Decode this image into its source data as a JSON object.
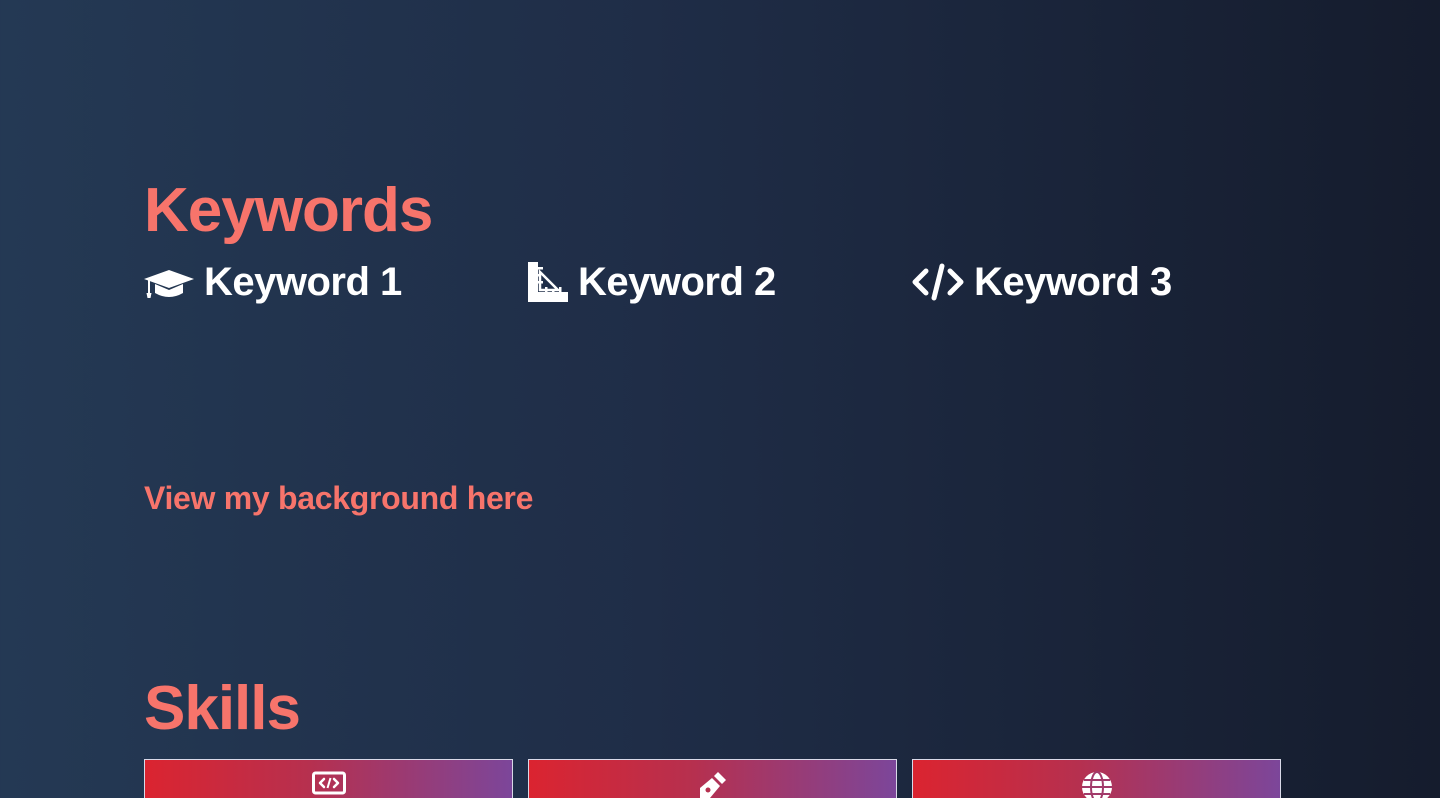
{
  "sections": {
    "keywords_title": "Keywords",
    "skills_title": "Skills"
  },
  "keywords": [
    {
      "label": "Keyword 1",
      "icon": "graduation-cap-icon"
    },
    {
      "label": "Keyword 2",
      "icon": "ruler-icon"
    },
    {
      "label": "Keyword 3",
      "icon": "code-icon"
    }
  ],
  "background_link": {
    "label": "View my background here"
  },
  "skills": [
    {
      "icon": "code-window-icon"
    },
    {
      "icon": "pen-nib-icon"
    },
    {
      "icon": "globe-icon"
    }
  ],
  "colors": {
    "accent": "#f7746b",
    "background_start": "#243954",
    "background_end": "#151c2d",
    "card_gradient_start": "#db2430",
    "card_gradient_end": "#7c469a"
  }
}
